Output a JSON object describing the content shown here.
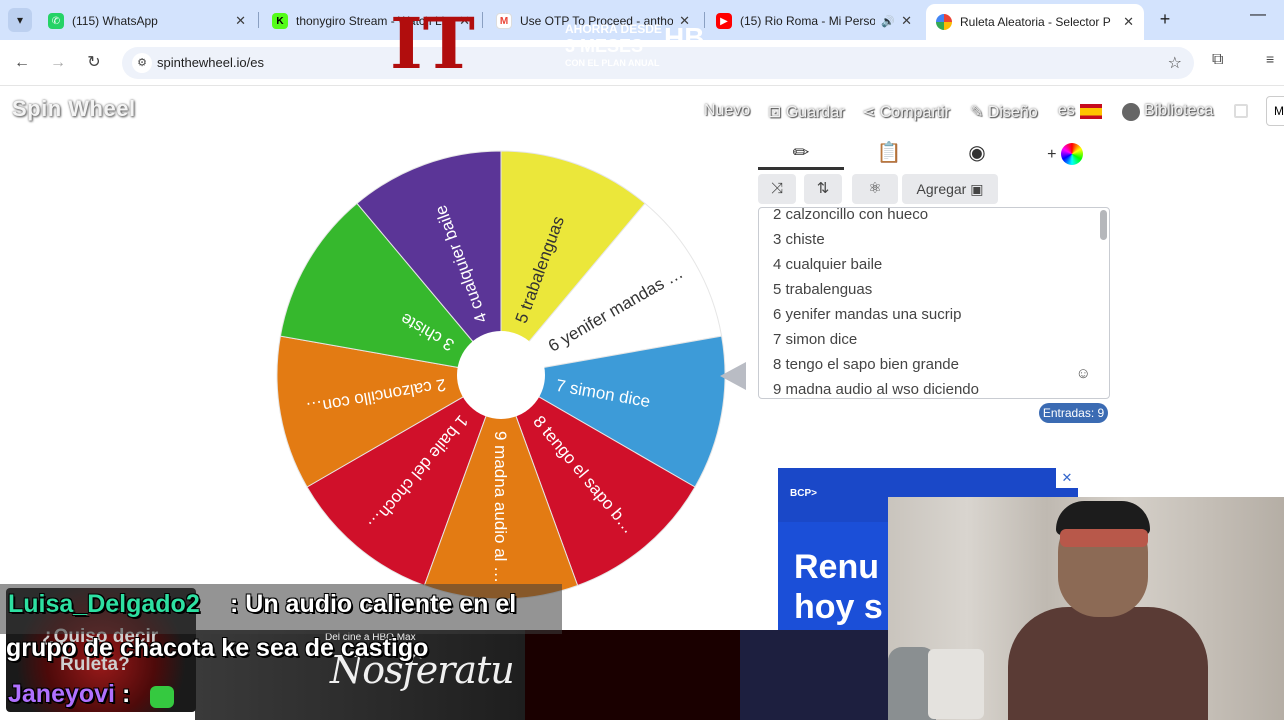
{
  "browser": {
    "tabs": [
      {
        "title": "(115) WhatsApp",
        "favicon_color": "#25d366",
        "active": false
      },
      {
        "title": "thonygiro Stream - Watch Li",
        "favicon_color": "#53fc18",
        "active": false
      },
      {
        "title": "Use OTP To Proceed - antho",
        "favicon_color": "#ea4335",
        "active": false
      },
      {
        "title": "(15) Rio Roma - Mi Perso",
        "favicon_color": "#ff0000",
        "active": false
      },
      {
        "title": "Ruleta Aleatoria - Selector P",
        "favicon_color": "#f5a623",
        "active": true
      }
    ],
    "new_tab": "+",
    "minimize": "—",
    "url": "spinthewheel.io/es"
  },
  "site": {
    "logo": "Spin Wheel",
    "nav": {
      "new": "Nuevo",
      "save": "Guardar",
      "share": "Compartir",
      "design": "Diseño",
      "language": "es",
      "library": "Biblioteca"
    },
    "profile_initial": "M"
  },
  "wheel": {
    "segments": [
      {
        "label": "1 baile del choch…",
        "color": "#d0102a"
      },
      {
        "label": "2 calzoncillo con…",
        "color": "#e37b13"
      },
      {
        "label": "3 chiste",
        "color": "#36b82d"
      },
      {
        "label": "4 cualquier baile",
        "color": "#5b3597"
      },
      {
        "label": "5 trabalenguas",
        "color": "#ebe73a"
      },
      {
        "label": "6 yenifer mandas …",
        "color": "#ffffff"
      },
      {
        "label": "7 simon dice",
        "color": "#3d9bd8"
      },
      {
        "label": "8 tengo el sapo b…",
        "color": "#d0102a"
      },
      {
        "label": "9 madna audio al …",
        "color": "#e37b13"
      }
    ]
  },
  "editor": {
    "tools": {
      "add_label": "Agregar"
    },
    "entries": [
      "2 calzoncillo con hueco",
      "3 chiste",
      "4 cualquier baile",
      "5 trabalenguas",
      "6 yenifer mandas una sucrip",
      "7 simon dice",
      "8 tengo el sapo bien grande",
      "9 madna audio al wso diciendo"
    ],
    "count_label": "Entradas: 9"
  },
  "ad": {
    "brand": "BCP>",
    "close": "✕",
    "line1": "Renu",
    "line2": "hoy s"
  },
  "stream": {
    "chat": [
      {
        "user": "Luisa_Delgado2",
        "message_line1": ": Un audio caliente en el",
        "message_line2": "grupo de chacota ke sea de castigo"
      },
      {
        "user": "Janeyovi",
        "message_line1": ":"
      }
    ],
    "roulette_tile": {
      "line1": "¿Quiso decir",
      "line2": "Ruleta?"
    },
    "banners": {
      "small_text": "Del cine a HBO Max",
      "movie_title": "Nosferatu",
      "it_title": "IT",
      "promo_line1": "AHORRA DESDE",
      "promo_line2": "3 MESES",
      "promo_line3": "CON EL PLAN ANUAL",
      "promo_logo": "HB"
    }
  }
}
